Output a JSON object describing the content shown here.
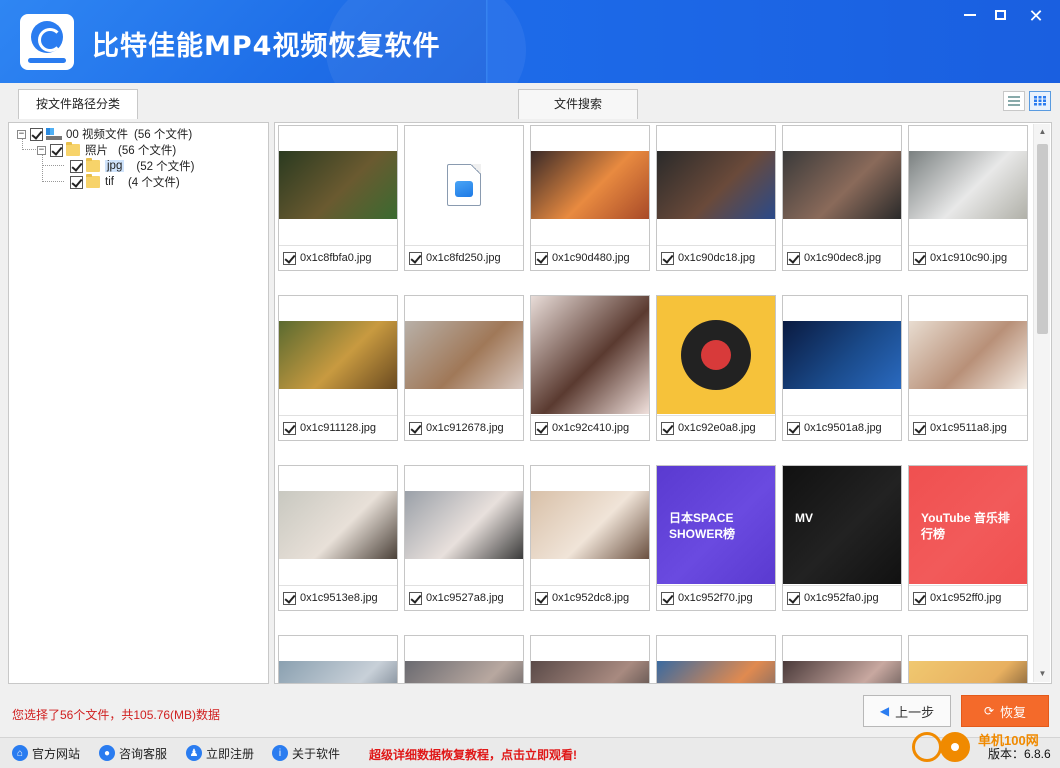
{
  "app": {
    "title": "比特佳能MP4视频恢复软件"
  },
  "window": {
    "min": "—",
    "max": "☐",
    "close": "✕"
  },
  "tabs": [
    {
      "label": "按文件路径分类"
    },
    {
      "label": "文件搜索"
    }
  ],
  "tree": {
    "root": {
      "label": "00 视频文件",
      "count": "(56 个文件)"
    },
    "photos": {
      "label": "照片",
      "count": "(56 个文件)"
    },
    "jpg": {
      "label": "jpg",
      "count": "(52 个文件)"
    },
    "tif": {
      "label": "tif",
      "count": "(4 个文件)"
    }
  },
  "thumbnails": [
    {
      "name": "0x1c8fbfa0.jpg",
      "colors": [
        "#2a3a20",
        "#6a5a30",
        "#3a6a30"
      ]
    },
    {
      "name": "0x1c8fd250.jpg",
      "colors": []
    },
    {
      "name": "0x1c90d480.jpg",
      "colors": [
        "#3a2a28",
        "#e88a40",
        "#a84a28"
      ]
    },
    {
      "name": "0x1c90dc18.jpg",
      "colors": [
        "#2a2a2a",
        "#6a4a3a",
        "#2a4a8a"
      ]
    },
    {
      "name": "0x1c90dec8.jpg",
      "colors": [
        "#3a3a3a",
        "#8a6a5a",
        "#2a2a2a"
      ]
    },
    {
      "name": "0x1c910c90.jpg",
      "colors": [
        "#7a8080",
        "#e8e8e8",
        "#b0b0a8"
      ]
    },
    {
      "name": "0x1c911128.jpg",
      "colors": [
        "#5a6a30",
        "#c89a40",
        "#6a4a20"
      ]
    },
    {
      "name": "0x1c912678.jpg",
      "colors": [
        "#b8b0a8",
        "#a07858",
        "#d8c8c0"
      ]
    },
    {
      "name": "0x1c92c410.jpg",
      "colors": [
        "#e8dcd8",
        "#5a3a30",
        "#f0e0dc"
      ]
    },
    {
      "name": "0x1c92e0a8.jpg",
      "colors": [
        "#f6c23a",
        "#222222",
        "#d83a3a"
      ]
    },
    {
      "name": "0x1c9501a8.jpg",
      "colors": [
        "#0a1a40",
        "#1a4a8a",
        "#2a6ac0"
      ]
    },
    {
      "name": "0x1c9511a8.jpg",
      "colors": [
        "#e8dcd0",
        "#b89078",
        "#f4ece4"
      ]
    },
    {
      "name": "0x1c9513e8.jpg",
      "colors": [
        "#c8c8c0",
        "#e8e0d8",
        "#4a4038"
      ]
    },
    {
      "name": "0x1c9527a8.jpg",
      "colors": [
        "#9aa0a8",
        "#e8e0dc",
        "#3a3a3a"
      ]
    },
    {
      "name": "0x1c952dc8.jpg",
      "colors": [
        "#d8c0a8",
        "#f0e4d8",
        "#6a5040"
      ]
    },
    {
      "name": "0x1c952f70.jpg",
      "colors": [
        "#5a3ad0",
        "#6a4ae0",
        "#5a3ad0"
      ],
      "overlay": "日本SPACE SHOWER榜"
    },
    {
      "name": "0x1c952fa0.jpg",
      "colors": [
        "#111111",
        "#222222",
        "#111111"
      ],
      "overlay": "MV"
    },
    {
      "name": "0x1c952ff0.jpg",
      "colors": [
        "#f05050",
        "#f25a5a",
        "#f05050"
      ],
      "overlay": "YouTube 音乐排行榜"
    },
    {
      "name": "",
      "colors": [
        "#8aa0b0",
        "#c8d0d8",
        "#4a5868"
      ]
    },
    {
      "name": "",
      "colors": [
        "#6a6a70",
        "#b8a8a0",
        "#3a3a40"
      ]
    },
    {
      "name": "",
      "colors": [
        "#5a4a48",
        "#a88a80",
        "#2a2a2a"
      ]
    },
    {
      "name": "",
      "colors": [
        "#3a6aa0",
        "#e08a50",
        "#4a5a70"
      ]
    },
    {
      "name": "",
      "colors": [
        "#4a3a3a",
        "#c8a8a0",
        "#2a2a2a"
      ]
    },
    {
      "name": "",
      "colors": [
        "#f0c870",
        "#e8b060",
        "#3a2a20"
      ]
    }
  ],
  "status": {
    "selection": "您选择了56个文件，共105.76(MB)数据"
  },
  "buttons": {
    "prev": "上一步",
    "recover": "恢复"
  },
  "footer": {
    "links": [
      {
        "label": "官方网站"
      },
      {
        "label": "咨询客服"
      },
      {
        "label": "立即注册"
      },
      {
        "label": "关于软件"
      }
    ],
    "promo": "超级详细数据恢复教程，点击立即观看!",
    "version": "版本：6.8.6"
  },
  "watermark": {
    "text": "单机100网"
  }
}
